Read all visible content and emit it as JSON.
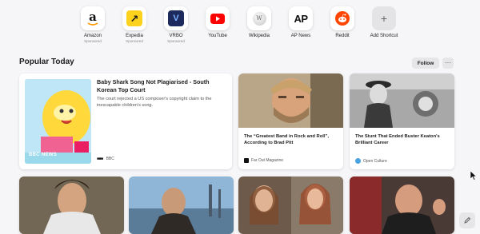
{
  "shortcuts": [
    {
      "name": "Amazon",
      "sub": "Sponsored",
      "icon": "amazon-icon"
    },
    {
      "name": "Expedia",
      "sub": "Sponsored",
      "icon": "expedia-icon"
    },
    {
      "name": "VRBO",
      "sub": "Sponsored",
      "icon": "vrbo-icon"
    },
    {
      "name": "YouTube",
      "sub": "",
      "icon": "youtube-icon"
    },
    {
      "name": "Wikipedia",
      "sub": "",
      "icon": "wikipedia-icon"
    },
    {
      "name": "AP News",
      "sub": "",
      "icon": "ap-news-icon"
    },
    {
      "name": "Reddit",
      "sub": "",
      "icon": "reddit-icon"
    },
    {
      "name": "Add Shortcut",
      "sub": "",
      "icon": "plus-icon"
    }
  ],
  "icons": {
    "amazon_letter": "a",
    "expedia_arrow": "↗",
    "vrbo_letter": "V",
    "ap_text": "AP",
    "wiki_letter": "W",
    "plus": "+"
  },
  "section": {
    "title": "Popular Today",
    "follow_label": "Follow",
    "more_label": "···"
  },
  "featured": {
    "title": "Baby Shark Song Not Plagiarised - South Korean Top Court",
    "description": "The court rejected a US composer's copyright claim to the inescapable children's song.",
    "source": "BBC",
    "image_text": "BBC NEWS"
  },
  "articles": [
    {
      "title": "The “Greatest Band in Rock and Roll”, According to Brad Pitt",
      "source": "Far Out Magazine"
    },
    {
      "title": "The Stunt That Ended Buster Keaton's Brilliant Career",
      "source": "Open Culture"
    }
  ],
  "colors": {
    "youtube": "#ff0000",
    "expedia": "#fcd21d",
    "vrbo": "#1c2a5e",
    "reddit": "#ff4500",
    "ap": "#e31b23",
    "background": "#f6f6f8"
  }
}
